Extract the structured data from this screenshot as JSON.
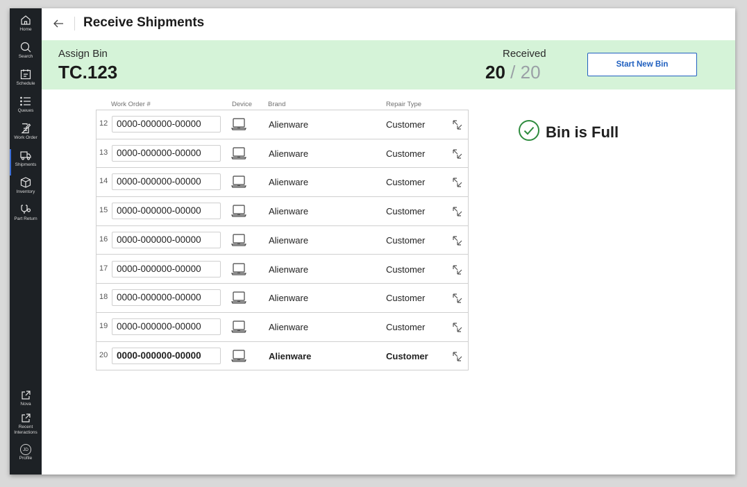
{
  "sidebar": {
    "items": [
      {
        "label": "Home",
        "icon": "home-icon"
      },
      {
        "label": "Search",
        "icon": "search-icon"
      },
      {
        "label": "Schedule",
        "icon": "calendar-icon"
      },
      {
        "label": "Queues",
        "icon": "list-icon"
      },
      {
        "label": "Work Order",
        "icon": "document-edit-icon"
      },
      {
        "label": "Shipments",
        "icon": "truck-icon",
        "active": true
      },
      {
        "label": "Inventory",
        "icon": "box-icon"
      },
      {
        "label": "Part Return",
        "icon": "part-return-icon"
      }
    ],
    "bottom_items": [
      {
        "label": "Nova",
        "icon": "external-link-icon"
      },
      {
        "label_line1": "Recent",
        "label_line2": "Interactions",
        "icon": "external-link-icon"
      },
      {
        "label": "Profile",
        "initials": "JD"
      }
    ]
  },
  "header": {
    "title": "Receive Shipments"
  },
  "band": {
    "assign_label": "Assign Bin",
    "bin_id": "TC.123",
    "received_label": "Received",
    "received_count": "20",
    "separator": "/",
    "received_total": "20",
    "start_button": "Start New Bin"
  },
  "table": {
    "headers": {
      "work_order": "Work Order #",
      "device": "Device",
      "brand": "Brand",
      "repair_type": "Repair Type"
    },
    "rows": [
      {
        "num": "12",
        "work_order": "0000-000000-00000",
        "brand": "Alienware",
        "repair_type": "Customer"
      },
      {
        "num": "13",
        "work_order": "0000-000000-00000",
        "brand": "Alienware",
        "repair_type": "Customer"
      },
      {
        "num": "14",
        "work_order": "0000-000000-00000",
        "brand": "Alienware",
        "repair_type": "Customer"
      },
      {
        "num": "15",
        "work_order": "0000-000000-00000",
        "brand": "Alienware",
        "repair_type": "Customer"
      },
      {
        "num": "16",
        "work_order": "0000-000000-00000",
        "brand": "Alienware",
        "repair_type": "Customer"
      },
      {
        "num": "17",
        "work_order": "0000-000000-00000",
        "brand": "Alienware",
        "repair_type": "Customer"
      },
      {
        "num": "18",
        "work_order": "0000-000000-00000",
        "brand": "Alienware",
        "repair_type": "Customer"
      },
      {
        "num": "19",
        "work_order": "0000-000000-00000",
        "brand": "Alienware",
        "repair_type": "Customer"
      },
      {
        "num": "20",
        "work_order": "0000-000000-00000",
        "brand": "Alienware",
        "repair_type": "Customer",
        "bold": true
      }
    ]
  },
  "status": {
    "text": "Bin is Full",
    "color": "#2e8b3e"
  },
  "colors": {
    "sidebar_bg": "#1d2125",
    "band_bg": "#d5f3d8",
    "accent": "#1f5fbf"
  }
}
